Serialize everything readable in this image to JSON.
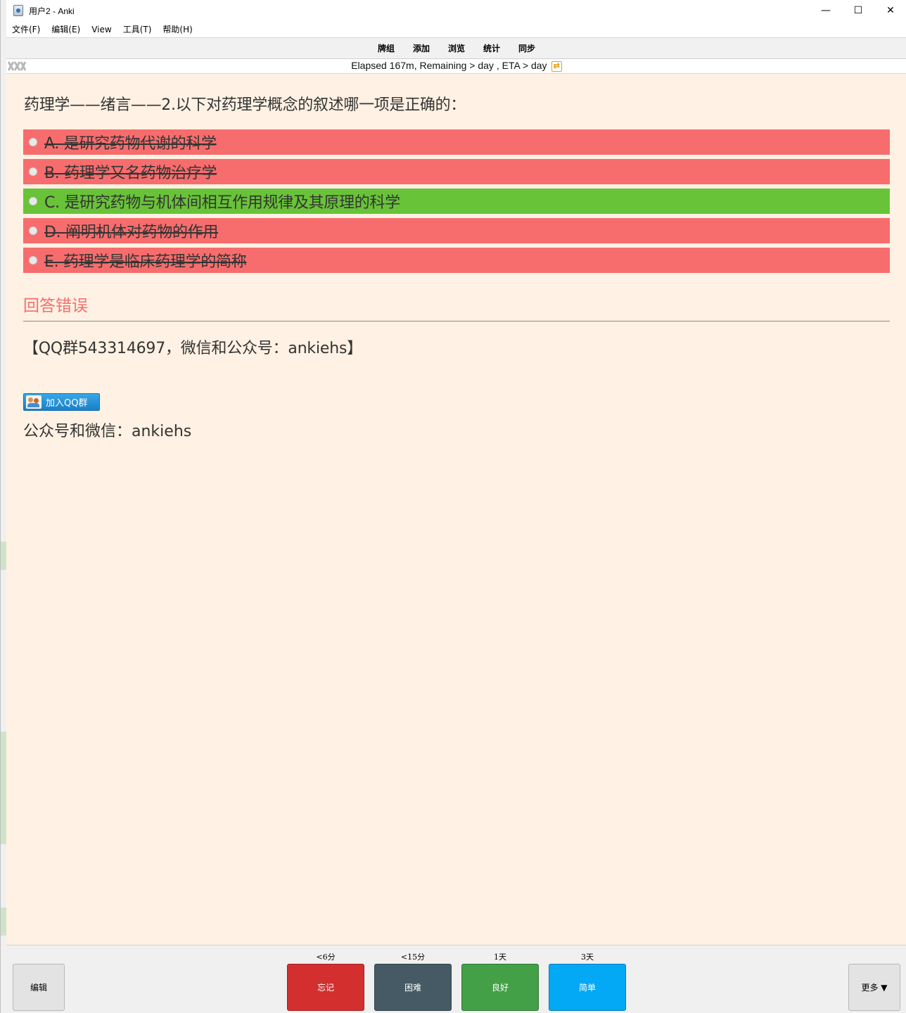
{
  "window": {
    "title": "用户2 - Anki",
    "controls": {
      "minimize": "—",
      "maximize": "☐",
      "close": "✕"
    }
  },
  "menubar": {
    "items": [
      "文件(F)",
      "编辑(E)",
      "View",
      "工具(T)",
      "帮助(H)"
    ]
  },
  "toolbar": {
    "items": [
      "牌组",
      "添加",
      "浏览",
      "统计",
      "同步"
    ]
  },
  "status": {
    "text": "Elapsed 167m, Remaining > day , ETA > day",
    "refresh_icon": "refresh-icon"
  },
  "card": {
    "question": "药理学——绪言——2.以下对药理学概念的叙述哪一项是正确的：",
    "options": [
      {
        "label": "A. 是研究药物代谢的科学",
        "state": "wrong"
      },
      {
        "label": "B. 药理学又名药物治疗学",
        "state": "wrong"
      },
      {
        "label": "C. 是研究药物与机体间相互作用规律及其原理的科学",
        "state": "correct"
      },
      {
        "label": "D. 阐明机体对药物的作用",
        "state": "wrong"
      },
      {
        "label": "E. 药理学是临床药理学的简称",
        "state": "wrong"
      }
    ],
    "result": "回答错误",
    "qq_info": "【QQ群543314697，微信和公众号：ankiehs】",
    "qq_button": "加入QQ群",
    "wechat_info": "公众号和微信：ankiehs"
  },
  "bottom": {
    "edit": "编辑",
    "more": "更多 ▼",
    "ease": [
      {
        "time": "<6分",
        "label": "忘记",
        "color": "#d32f2f"
      },
      {
        "time": "<15分",
        "label": "困难",
        "color": "#455a64"
      },
      {
        "time": "1天",
        "label": "良好",
        "color": "#43a047"
      },
      {
        "time": "3天",
        "label": "简单",
        "color": "#03a9f4"
      }
    ]
  },
  "colors": {
    "wrong_bg": "#f76d6d",
    "correct_bg": "#68c338",
    "card_bg": "#fff1e3"
  }
}
